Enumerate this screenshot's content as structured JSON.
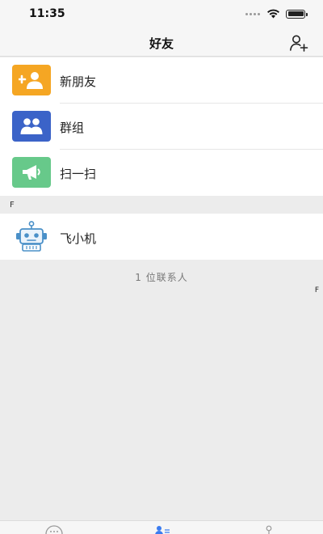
{
  "status_bar": {
    "time": "11:35"
  },
  "nav": {
    "title": "好友"
  },
  "menu": [
    {
      "label": "新朋友",
      "icon": "add-contact-icon",
      "color": "#f5a623"
    },
    {
      "label": "群组",
      "icon": "group-icon",
      "color": "#3b63c8"
    },
    {
      "label": "扫一扫",
      "icon": "megaphone-icon",
      "color": "#67c98a"
    }
  ],
  "section": {
    "letter": "F"
  },
  "contacts": [
    {
      "name": "飞小机",
      "avatar": "robot-icon"
    }
  ],
  "contact_count": "1 位联系人",
  "index_bar": [
    "F"
  ],
  "colors": {
    "background": "#ececec",
    "accent": "#3b7cf0",
    "orange": "#f5a623",
    "blue": "#3b63c8",
    "green": "#67c98a"
  }
}
